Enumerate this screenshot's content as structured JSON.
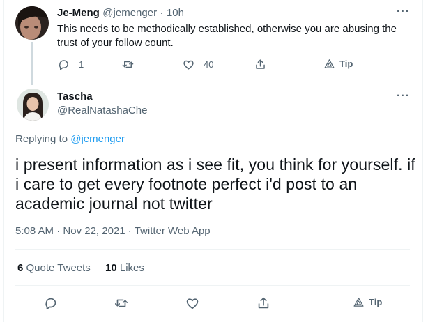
{
  "reply": {
    "author_name": "Je-Meng",
    "handle": "@jemenger",
    "separator": "·",
    "time": "10h",
    "text": "This needs to be methodically established, otherwise you are abusing the trust of your follow count.",
    "replies": "1",
    "likes": "40",
    "tip_label": "Tip"
  },
  "main": {
    "author_name": "Tascha",
    "handle": "@RealNatashaChe",
    "replying_prefix": "Replying to",
    "replying_handle": "@jemenger",
    "text": "i present information as i see fit, you think for yourself. if i care to get every footnote perfect i'd post to an academic journal not twitter",
    "time": "5:08 AM",
    "date": "Nov 22, 2021",
    "source": "Twitter Web App",
    "sep": "·",
    "quote_tweets_count": "6",
    "quote_tweets_label": "Quote Tweets",
    "likes_count": "10",
    "likes_label": "Likes",
    "tip_label": "Tip"
  },
  "more_glyph": "···"
}
